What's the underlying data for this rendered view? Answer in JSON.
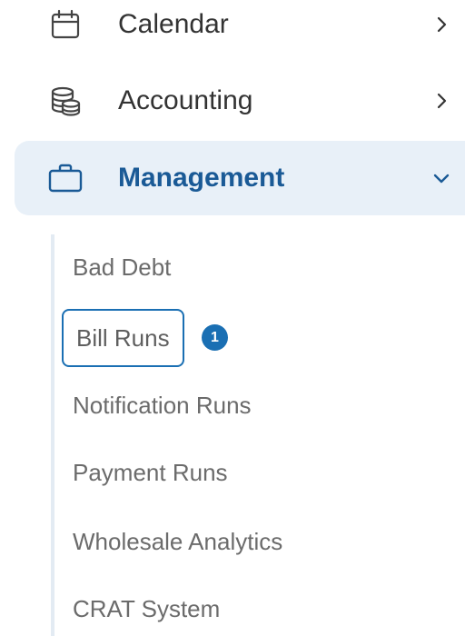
{
  "nav": {
    "items": [
      {
        "label": "Calendar",
        "icon": "calendar-icon",
        "chevron": "chevron-right-icon"
      },
      {
        "label": "Accounting",
        "icon": "database-icon",
        "chevron": "chevron-right-icon"
      },
      {
        "label": "Management",
        "icon": "briefcase-icon",
        "chevron": "chevron-down-icon",
        "expanded": true
      }
    ],
    "submenu": [
      {
        "label": "Bad Debt"
      },
      {
        "label": "Bill Runs",
        "badge": "1",
        "focused": true
      },
      {
        "label": "Notification Runs"
      },
      {
        "label": "Payment Runs"
      },
      {
        "label": "Wholesale Analytics"
      },
      {
        "label": "CRAT System"
      }
    ]
  },
  "colors": {
    "accent": "#1a6fb3",
    "active_background": "#e8f0f8",
    "active_text": "#1a5a96",
    "text": "#333333",
    "submenu_text": "#6b6b6b",
    "submenu_rail": "#e3ebf3"
  }
}
